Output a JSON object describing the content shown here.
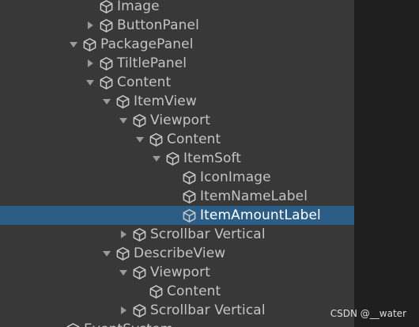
{
  "hierarchy": {
    "items": [
      {
        "label": "Image",
        "depth": 2,
        "arrow": "none",
        "selected": false
      },
      {
        "label": "ButtonPanel",
        "depth": 2,
        "arrow": "collapsed",
        "selected": false
      },
      {
        "label": "PackagePanel",
        "depth": 1,
        "arrow": "expanded",
        "selected": false
      },
      {
        "label": "TiltlePanel",
        "depth": 2,
        "arrow": "collapsed",
        "selected": false
      },
      {
        "label": "Content",
        "depth": 2,
        "arrow": "expanded",
        "selected": false
      },
      {
        "label": "ItemView",
        "depth": 3,
        "arrow": "expanded",
        "selected": false
      },
      {
        "label": "Viewport",
        "depth": 4,
        "arrow": "expanded",
        "selected": false
      },
      {
        "label": "Content",
        "depth": 5,
        "arrow": "expanded",
        "selected": false
      },
      {
        "label": "ItemSoft",
        "depth": 6,
        "arrow": "expanded",
        "selected": false
      },
      {
        "label": "IconImage",
        "depth": 7,
        "arrow": "none",
        "selected": false
      },
      {
        "label": "ItemNameLabel",
        "depth": 7,
        "arrow": "none",
        "selected": false
      },
      {
        "label": "ItemAmountLabel",
        "depth": 7,
        "arrow": "none",
        "selected": true
      },
      {
        "label": "Scrollbar Vertical",
        "depth": 4,
        "arrow": "collapsed",
        "selected": false
      },
      {
        "label": "DescribeView",
        "depth": 3,
        "arrow": "expanded",
        "selected": false
      },
      {
        "label": "Viewport",
        "depth": 4,
        "arrow": "expanded",
        "selected": false
      },
      {
        "label": "Content",
        "depth": 5,
        "arrow": "none",
        "selected": false
      },
      {
        "label": "Scrollbar Vertical",
        "depth": 4,
        "arrow": "collapsed",
        "selected": false
      },
      {
        "label": "EventSystem",
        "depth": 0,
        "arrow": "none",
        "selected": false
      }
    ]
  },
  "watermark": "CSDN @__water",
  "colors": {
    "panel_bg": "#383838",
    "selection": "#2c5d87",
    "text": "#c4c4c4",
    "text_selected": "#ffffff",
    "icon": "#c8c8c8"
  },
  "icons": {
    "expanded": "triangle-down-icon",
    "collapsed": "triangle-right-icon",
    "object": "cube-icon"
  }
}
